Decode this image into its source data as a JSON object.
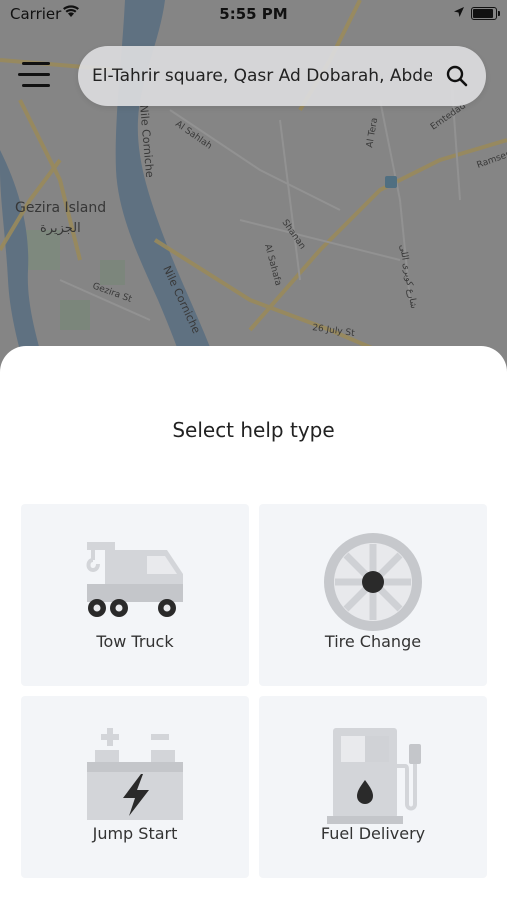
{
  "status_bar": {
    "carrier": "Carrier",
    "time": "5:55 PM"
  },
  "map": {
    "labels": {
      "gezira_en": "Gezira Island",
      "gezira_ar": "الجزيرة",
      "nile_corniche_1": "Nile Corniche",
      "nile_corniche_2": "Nile Corniche",
      "al_sahlah": "Al Sahlah",
      "al_tera": "Al Tera",
      "emtedad": "Emtedad",
      "ramses": "Ramses",
      "shanan": "Shanan",
      "al_sahafa": "Al Sahafa",
      "arabic_street": "شارع كوبرى اللى",
      "gezira_st": "Gezira St",
      "july_26": "26 July St"
    }
  },
  "search": {
    "value": "El-Tahrir square, Qasr Ad Dobarah, Abdeen"
  },
  "sheet": {
    "title": "Select help type",
    "options": [
      {
        "label": "Tow Truck",
        "icon": "tow-truck-icon"
      },
      {
        "label": "Tire Change",
        "icon": "tire-icon"
      },
      {
        "label": "Jump Start",
        "icon": "battery-icon"
      },
      {
        "label": "Fuel Delivery",
        "icon": "fuel-pump-icon"
      }
    ]
  },
  "colors": {
    "overlay": "#6e6e6e",
    "tile_bg": "#f3f5f8",
    "icon_gray": "#d3d5d9",
    "icon_dark": "#2a2a2a"
  }
}
